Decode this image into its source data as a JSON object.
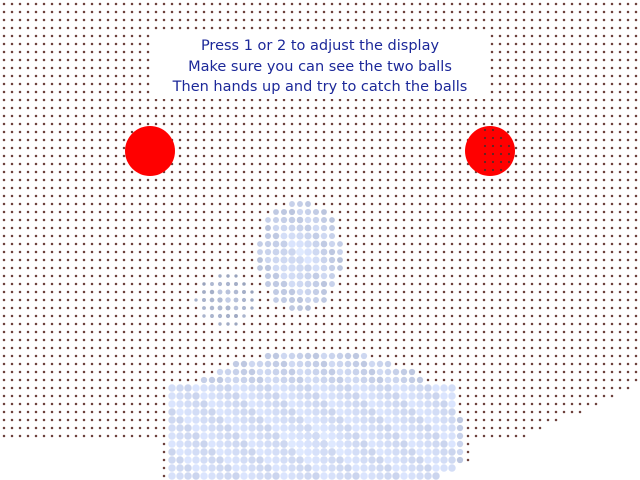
{
  "instructions": {
    "line1": "Press 1 or 2 to adjust the display",
    "line2": "Make sure you can see the two balls",
    "line3": "Then hands up and try to catch the balls"
  },
  "colors": {
    "ball": "#ff0000",
    "text": "#1c2899",
    "dot_background": "#6b3f3a",
    "figure_tint": "#a8b4bb"
  },
  "game": {
    "balls": [
      "left-ball",
      "right-ball"
    ]
  }
}
